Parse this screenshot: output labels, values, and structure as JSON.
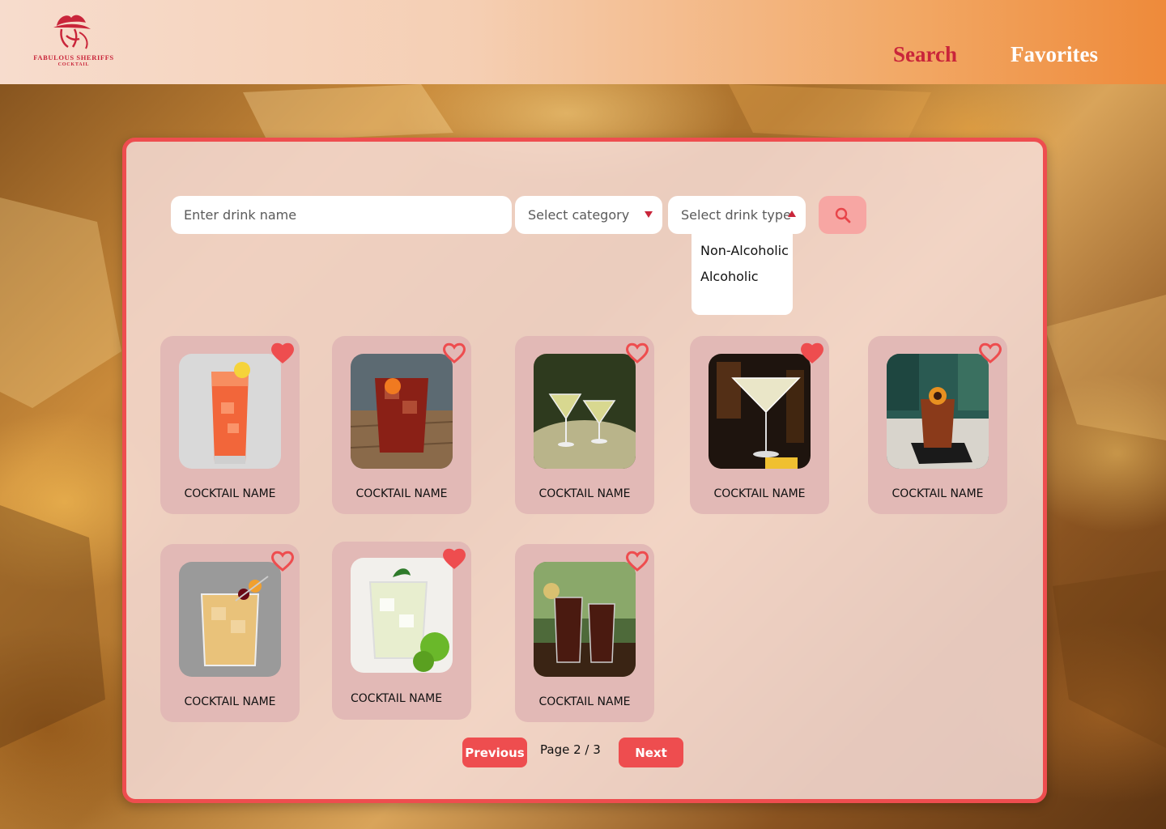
{
  "brand": {
    "line1": "FABULOUS SHERIFFS",
    "line2": "COCKTAIL"
  },
  "nav": {
    "search": "Search",
    "favorites": "Favorites"
  },
  "colors": {
    "accent": "#ee4d4f",
    "brand_red": "#c9253a",
    "card_bg": "#e2b9b6"
  },
  "search": {
    "name_placeholder": "Enter drink name",
    "category_label": "Select category",
    "type_label": "Select drink type",
    "button_icon": "search-icon"
  },
  "type_dropdown": {
    "open": true,
    "options": [
      "Non-Alcoholic",
      "Alcoholic"
    ]
  },
  "cards": [
    {
      "name": "COCKTAIL NAME",
      "favorite": true
    },
    {
      "name": "COCKTAIL NAME",
      "favorite": false
    },
    {
      "name": "COCKTAIL NAME",
      "favorite": false
    },
    {
      "name": "COCKTAIL NAME",
      "favorite": true
    },
    {
      "name": "COCKTAIL NAME",
      "favorite": false
    },
    {
      "name": "COCKTAIL NAME",
      "favorite": false
    },
    {
      "name": "COCKTAIL NAME",
      "favorite": true
    },
    {
      "name": "COCKTAIL NAME",
      "favorite": false
    }
  ],
  "pagination": {
    "previous": "Previous",
    "page": "Page 2 / 3",
    "next": "Next"
  }
}
